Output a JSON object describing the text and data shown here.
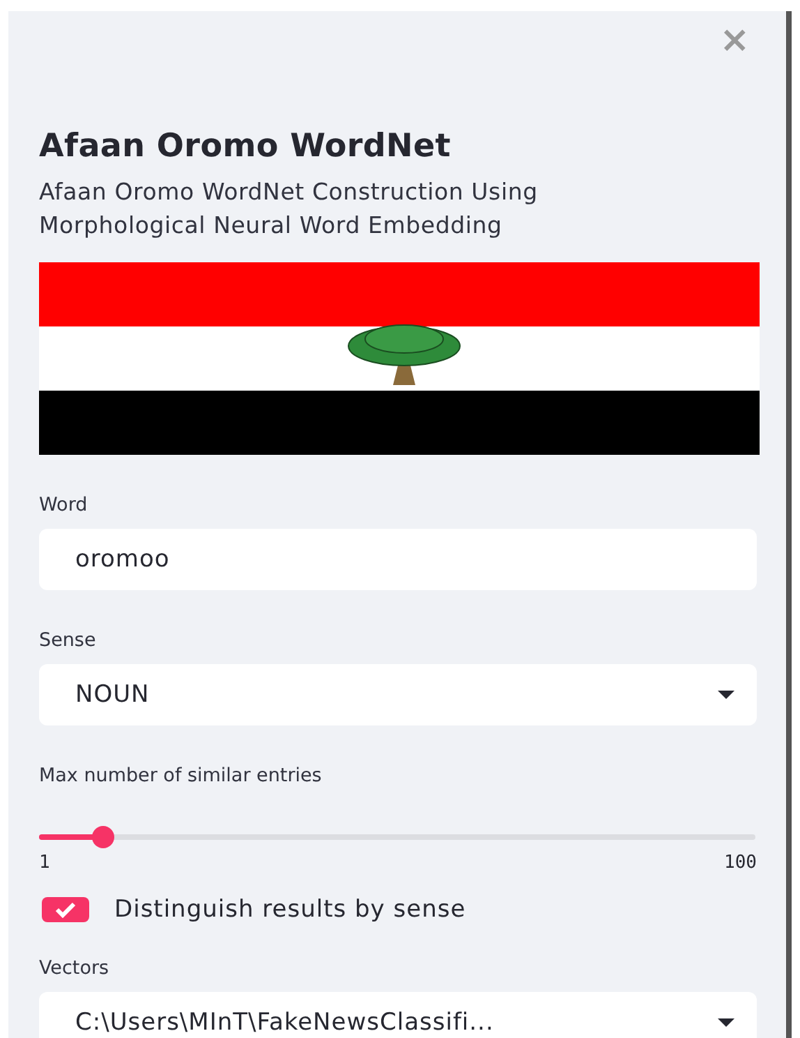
{
  "sidebar": {
    "close_button": "×",
    "title": "Afaan Oromo WordNet",
    "subtitle": "Afaan Oromo WordNet Construction Using Morphological Neural Word Embedding",
    "word": {
      "label": "Word",
      "value": "oromoo"
    },
    "sense": {
      "label": "Sense",
      "value": "NOUN"
    },
    "max_entries": {
      "label": "Max number of similar entries",
      "level": 0.09,
      "min": "1",
      "max": "100"
    },
    "distinguish": {
      "label": "Distinguish results by sense",
      "checked": true
    },
    "vectors": {
      "label": "Vectors",
      "value": "C:\\Users\\MInT\\FakeNewsClassifi..."
    }
  }
}
